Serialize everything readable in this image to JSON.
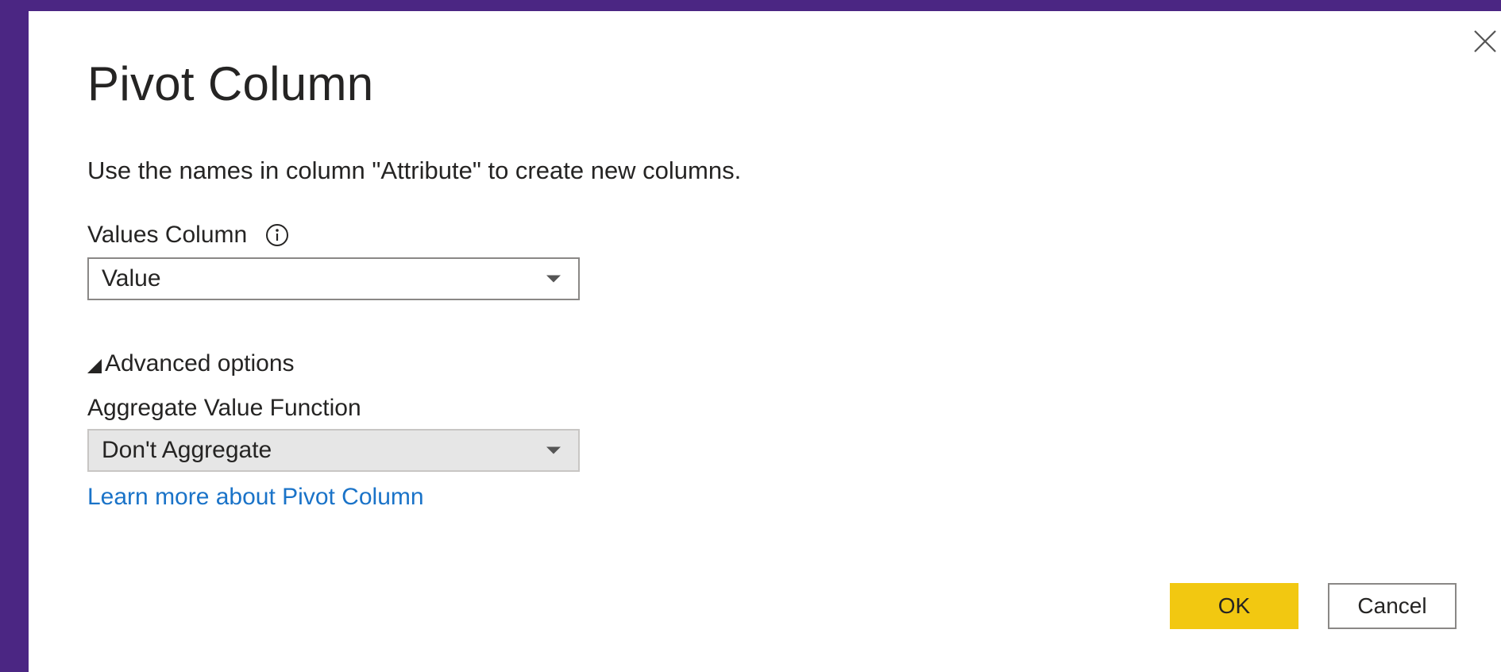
{
  "dialog": {
    "title": "Pivot Column",
    "description": "Use the names in column \"Attribute\" to create new columns.",
    "close_icon": "close-icon"
  },
  "values_column": {
    "label": "Values Column",
    "info_icon": "info-icon",
    "selected": "Value"
  },
  "advanced": {
    "toggle_label": "Advanced options",
    "expanded": true,
    "aggregate_label": "Aggregate Value Function",
    "aggregate_selected": "Don't Aggregate"
  },
  "learn_more": {
    "text": "Learn more about Pivot Column"
  },
  "buttons": {
    "ok": "OK",
    "cancel": "Cancel"
  },
  "colors": {
    "backdrop": "#4b2683",
    "ok_button": "#f2c811",
    "link": "#1a73c8"
  }
}
